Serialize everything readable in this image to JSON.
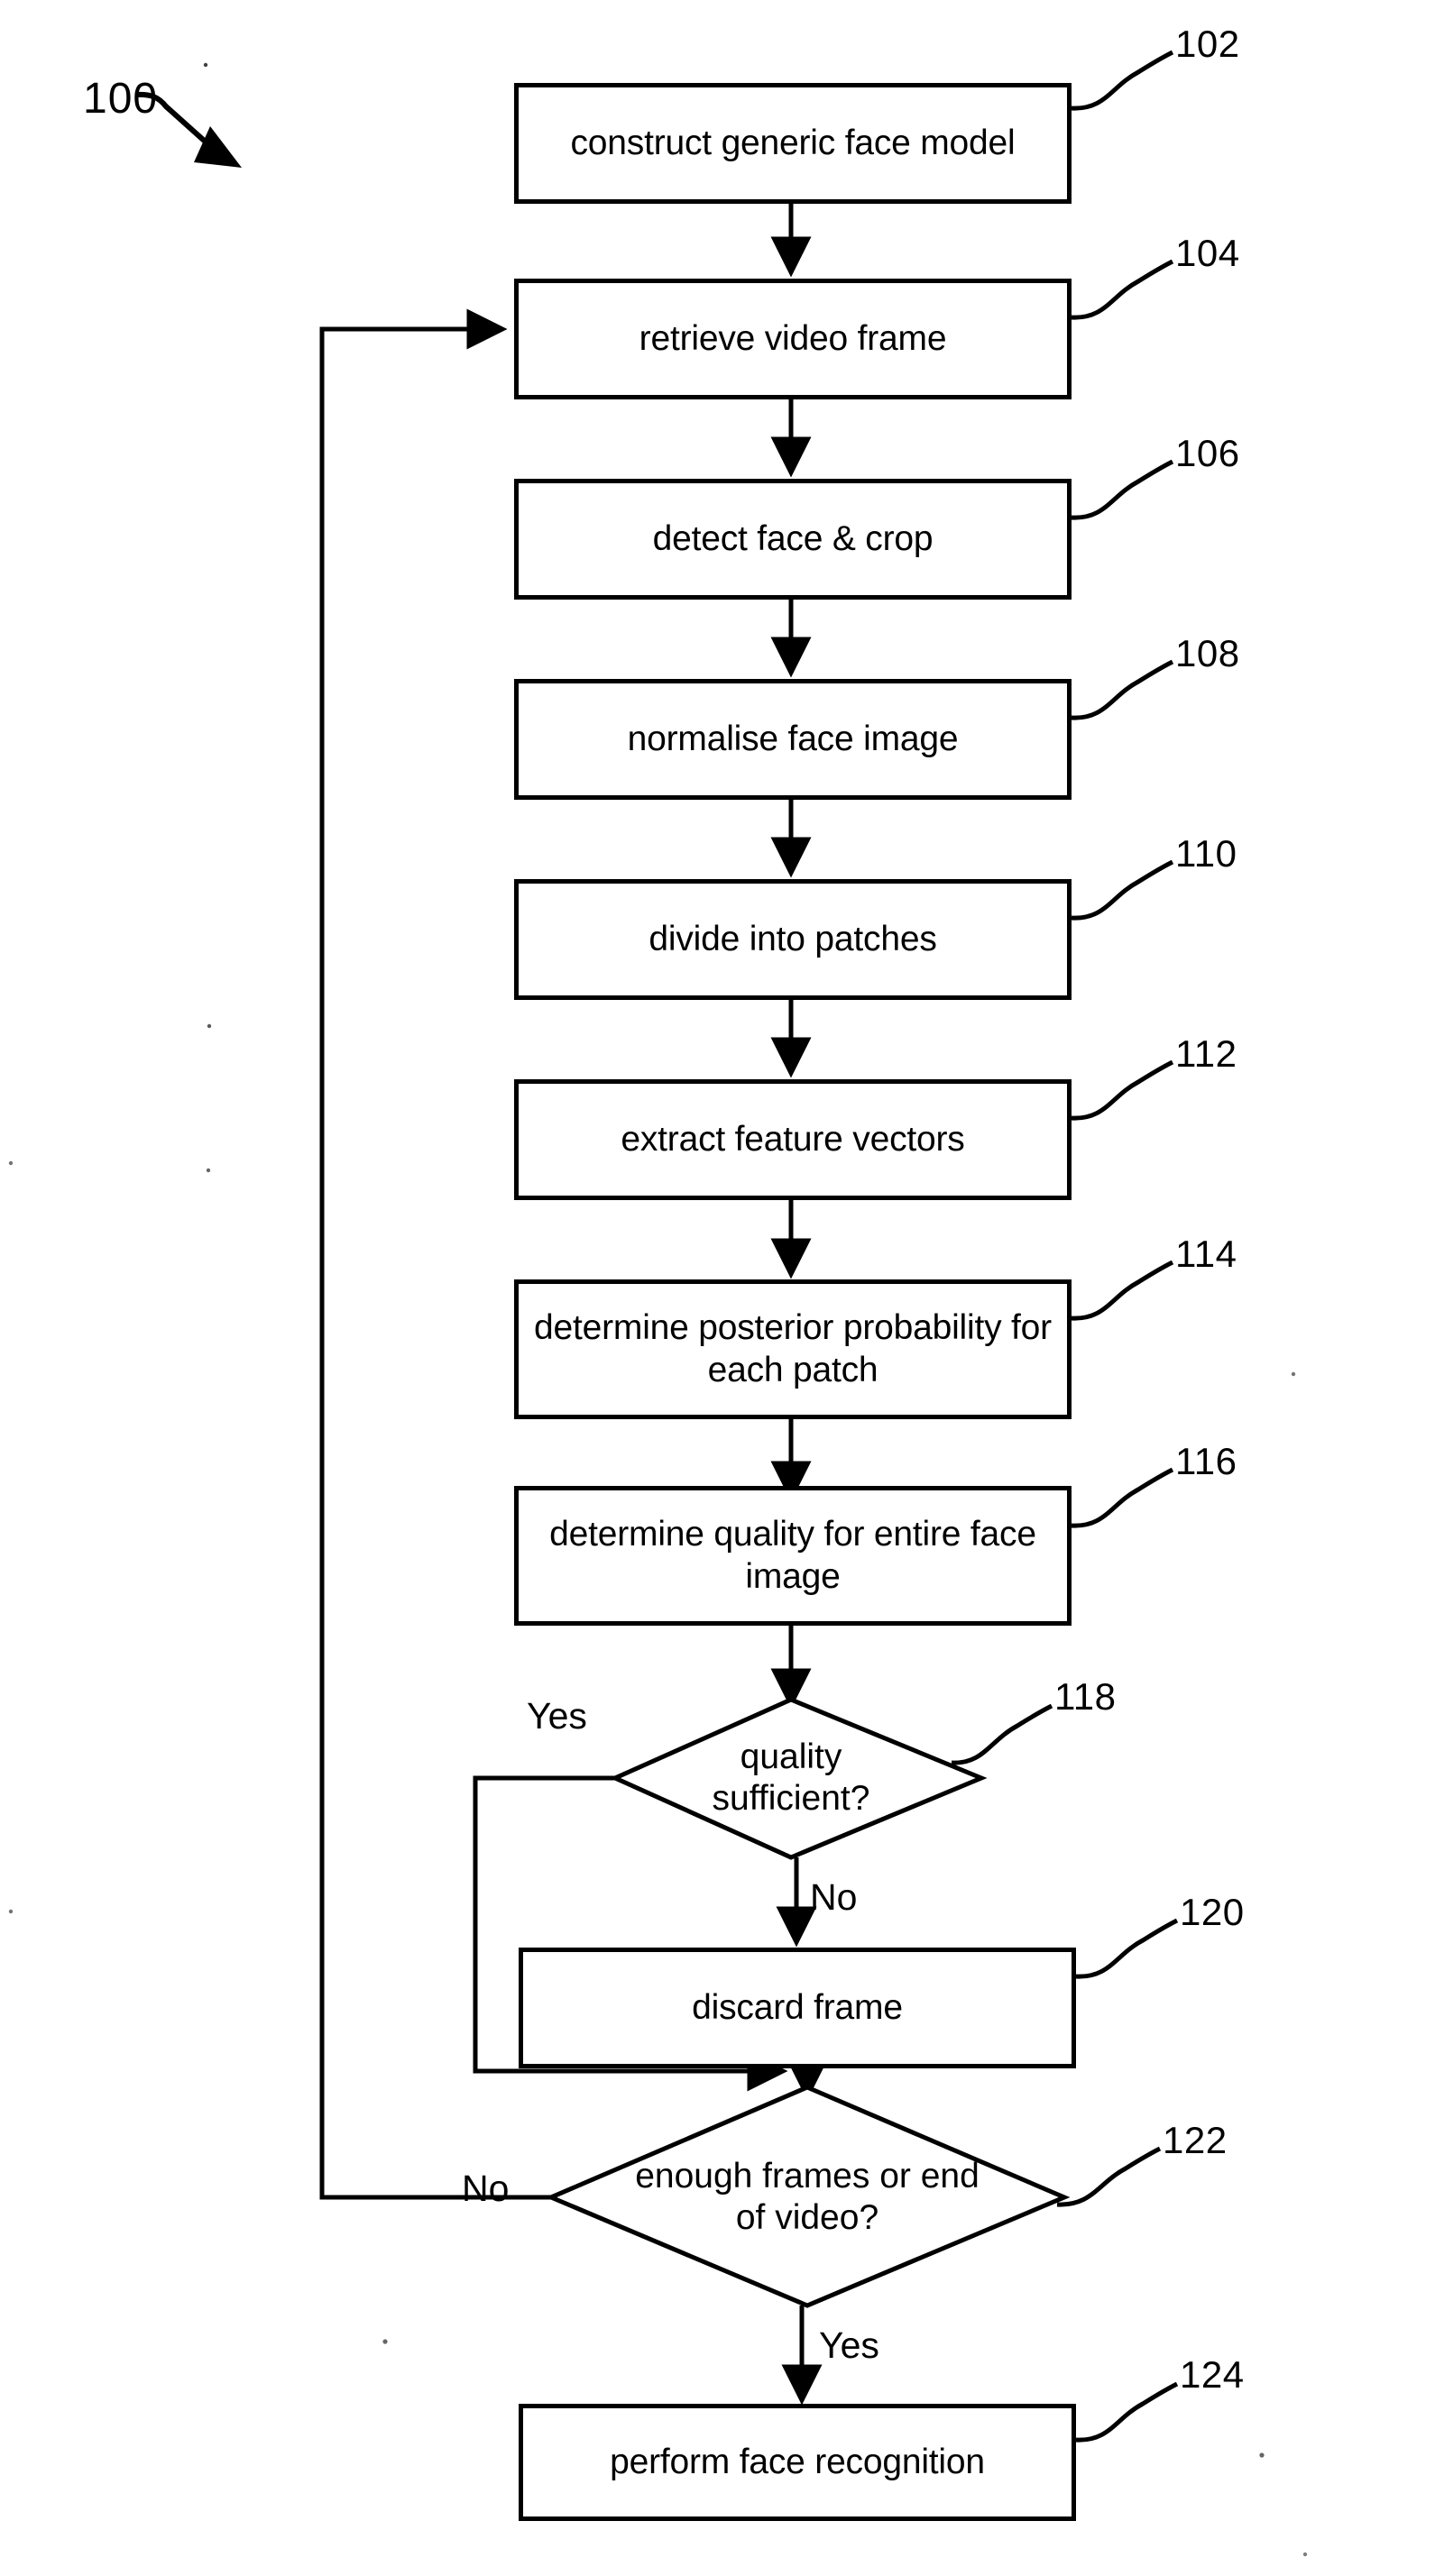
{
  "figure": {
    "number_label": "100",
    "type": "flowchart"
  },
  "chart_data": {
    "type": "diagram",
    "title": "",
    "nodes": [
      {
        "id": "102",
        "shape": "process",
        "label": "construct generic face model",
        "ref": "102"
      },
      {
        "id": "104",
        "shape": "process",
        "label": "retrieve video frame",
        "ref": "104"
      },
      {
        "id": "106",
        "shape": "process",
        "label": "detect face & crop",
        "ref": "106"
      },
      {
        "id": "108",
        "shape": "process",
        "label": "normalise face image",
        "ref": "108"
      },
      {
        "id": "110",
        "shape": "process",
        "label": "divide into patches",
        "ref": "110"
      },
      {
        "id": "112",
        "shape": "process",
        "label": "extract feature vectors",
        "ref": "112"
      },
      {
        "id": "114",
        "shape": "process",
        "label": "determine posterior probability for each patch",
        "ref": "114"
      },
      {
        "id": "116",
        "shape": "process",
        "label": "determine quality for entire face image",
        "ref": "116"
      },
      {
        "id": "118",
        "shape": "decision",
        "label": "quality sufficient?",
        "ref": "118"
      },
      {
        "id": "120",
        "shape": "process",
        "label": "discard frame",
        "ref": "120"
      },
      {
        "id": "122",
        "shape": "decision",
        "label": "enough frames or end of video?",
        "ref": "122"
      },
      {
        "id": "124",
        "shape": "process",
        "label": "perform face recognition",
        "ref": "124"
      }
    ],
    "edge_labels": {
      "quality_yes": "Yes",
      "quality_no": "No",
      "enough_no": "No",
      "enough_yes": "Yes"
    },
    "edges": [
      {
        "from": "102",
        "to": "104",
        "label": ""
      },
      {
        "from": "104",
        "to": "106",
        "label": ""
      },
      {
        "from": "106",
        "to": "108",
        "label": ""
      },
      {
        "from": "108",
        "to": "110",
        "label": ""
      },
      {
        "from": "110",
        "to": "112",
        "label": ""
      },
      {
        "from": "112",
        "to": "114",
        "label": ""
      },
      {
        "from": "114",
        "to": "116",
        "label": ""
      },
      {
        "from": "116",
        "to": "118",
        "label": ""
      },
      {
        "from": "118",
        "to": "120",
        "label": "No"
      },
      {
        "from": "118",
        "to": "122",
        "label": "Yes"
      },
      {
        "from": "120",
        "to": "122",
        "label": ""
      },
      {
        "from": "122",
        "to": "104",
        "label": "No"
      },
      {
        "from": "122",
        "to": "124",
        "label": "Yes"
      }
    ]
  },
  "nodes_text": {
    "n102": "construct generic face model",
    "n104": "retrieve video frame",
    "n106": "detect face & crop",
    "n108": "normalise face image",
    "n110": "divide into patches",
    "n112": "extract feature vectors",
    "n114": "determine posterior probability for each patch",
    "n116": "determine quality for entire face image",
    "n118": "quality sufficient?",
    "n120": "discard frame",
    "n122": "enough frames or end of video?",
    "n124": "perform face recognition"
  },
  "refs": {
    "r100": "100",
    "r102": "102",
    "r104": "104",
    "r106": "106",
    "r108": "108",
    "r110": "110",
    "r112": "112",
    "r114": "114",
    "r116": "116",
    "r118": "118",
    "r120": "120",
    "r122": "122",
    "r124": "124"
  },
  "labels": {
    "yes_quality": "Yes",
    "no_quality": "No",
    "no_enough": "No",
    "yes_enough": "Yes"
  },
  "colors": {
    "stroke": "#000000",
    "background": "#ffffff"
  }
}
